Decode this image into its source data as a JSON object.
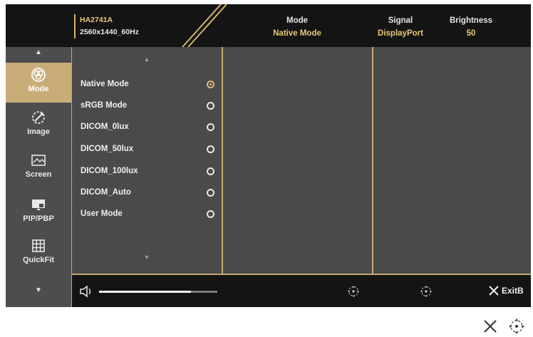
{
  "header": {
    "model": "HA2741A",
    "resolution": "2560x1440_60Hz",
    "mode_label": "Mode",
    "mode_value": "Native Mode",
    "signal_label": "Signal",
    "signal_value": "DisplayPort",
    "brightness_label": "Brightness",
    "brightness_value": "50"
  },
  "sidebar": {
    "items": [
      {
        "label": "Mode",
        "icon": "mode-icon",
        "active": true
      },
      {
        "label": "Image",
        "icon": "image-icon",
        "active": false
      },
      {
        "label": "Screen",
        "icon": "screen-icon",
        "active": false
      },
      {
        "label": "PIP/PBP",
        "icon": "pip-pbp-icon",
        "active": false
      },
      {
        "label": "QuickFit",
        "icon": "quickfit-icon",
        "active": false
      }
    ]
  },
  "mode_options": [
    {
      "label": "Native Mode",
      "selected": true
    },
    {
      "label": "sRGB Mode",
      "selected": false
    },
    {
      "label": "DICOM_0lux",
      "selected": false
    },
    {
      "label": "DICOM_50lux",
      "selected": false
    },
    {
      "label": "DICOM_100lux",
      "selected": false
    },
    {
      "label": "DICOM_Auto",
      "selected": false
    },
    {
      "label": "User Mode",
      "selected": false
    }
  ],
  "footer": {
    "volume_level": 0.78,
    "exit_label": "ExitB"
  },
  "colors": {
    "accent_gold": "#c9ad79",
    "header_value": "#e8c878",
    "osd_bg": "#4a4a4a",
    "bar_bg": "#141414"
  }
}
